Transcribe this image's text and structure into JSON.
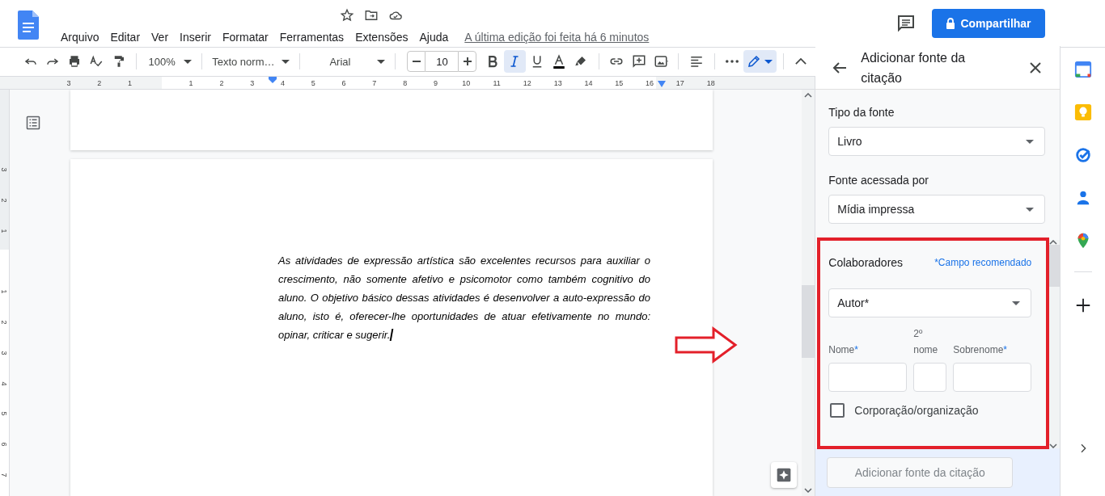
{
  "header": {
    "menus": [
      "Arquivo",
      "Editar",
      "Ver",
      "Inserir",
      "Formatar",
      "Ferramentas",
      "Extensões",
      "Ajuda"
    ],
    "last_edit": "A última edição foi feita há 6 minutos",
    "share_button": "Compartilhar"
  },
  "toolbar": {
    "zoom": "100%",
    "style": "Texto norm…",
    "font": "Arial",
    "font_size": "10",
    "bold": false,
    "italic": true,
    "underline": false
  },
  "ruler": {
    "top_labels": [
      "3",
      "2",
      "1",
      "1",
      "2",
      "3",
      "4",
      "5",
      "6",
      "7",
      "8",
      "9",
      "10",
      "11",
      "12",
      "13",
      "14",
      "15",
      "16",
      "17",
      "18"
    ],
    "side_labels": [
      "3",
      "2",
      "1",
      "1",
      "2",
      "3",
      "4",
      "5",
      "6",
      "7"
    ]
  },
  "document": {
    "paragraph": "As atividades de expressão artística são excelentes recursos para auxiliar o crescimento, não somente afetivo e psicomotor como também cognitivo do aluno. O objetivo básico dessas atividades é desenvolver a auto-expressão do aluno, isto é, oferecer-lhe oportunidades de atuar efetivamente no mundo: opinar, criticar e sugerir."
  },
  "citation_panel": {
    "title": "Adicionar fonte da citação",
    "fields": [
      {
        "label": "Tipo da fonte",
        "value": "Livro"
      },
      {
        "label": "Fonte acessada por",
        "value": "Mídia impressa"
      }
    ],
    "contributors": {
      "title": "Colaboradores",
      "hint": "*Campo recomendado",
      "role": "Autor*",
      "name_fields": [
        {
          "label": "Nome",
          "required_mark": "*"
        },
        {
          "label": "2º nome"
        },
        {
          "label": "Sobrenome",
          "required_mark": "*"
        }
      ],
      "corporation": {
        "label": "Corporação/organização",
        "checked": false
      }
    },
    "submit_button": "Adicionar fonte da citação"
  }
}
